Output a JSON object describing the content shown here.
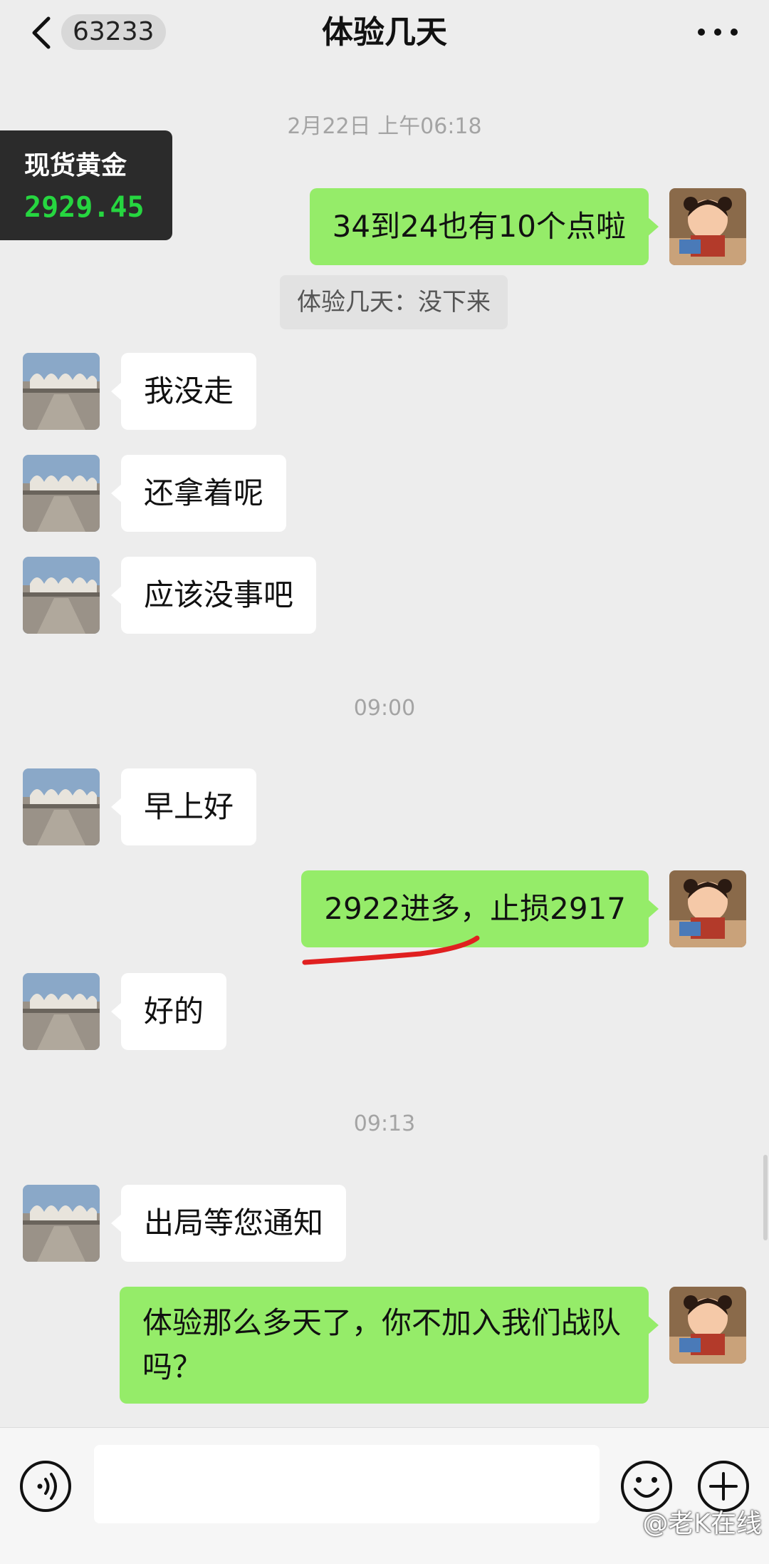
{
  "header": {
    "unread_count": "63233",
    "title": "体验几天"
  },
  "gold_widget": {
    "label": "现货黄金",
    "price": "2929.45"
  },
  "timestamps": [
    "2月22日 上午06:18",
    "09:00",
    "09:13"
  ],
  "messages": [
    {
      "side": "right",
      "text": "34到24也有10个点啦"
    },
    {
      "side": "quote",
      "text": "体验几天：没下来"
    },
    {
      "side": "left",
      "text": "我没走"
    },
    {
      "side": "left",
      "text": "还拿着呢"
    },
    {
      "side": "left",
      "text": "应该没事吧"
    },
    {
      "side": "left",
      "text": "早上好"
    },
    {
      "side": "right",
      "text": "2922进多，止损2917"
    },
    {
      "side": "left",
      "text": "好的"
    },
    {
      "side": "left",
      "text": "出局等您通知"
    },
    {
      "side": "right",
      "text": "体验那么多天了，你不加入我们战队吗？"
    }
  ],
  "input": {
    "value": "",
    "placeholder": ""
  },
  "watermark": "@老K在线",
  "colors": {
    "background": "#ededed",
    "bubble_right": "#95ec69",
    "bubble_left": "#ffffff",
    "gold_price": "#26d640",
    "annotation_red": "#e02020"
  },
  "icons": [
    "back-icon",
    "more-icon",
    "voice-icon",
    "emoji-icon",
    "plus-icon"
  ]
}
